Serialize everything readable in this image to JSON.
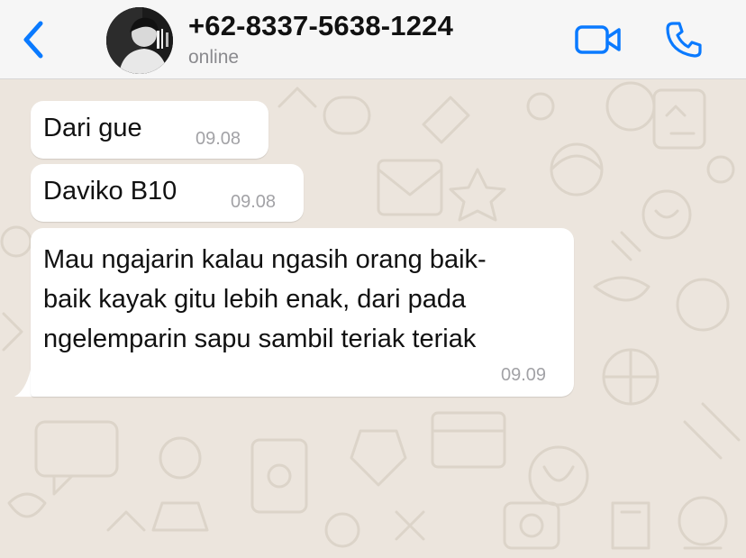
{
  "header": {
    "back_icon": "chevron-left-icon",
    "contact_name": "+62-8337-5638-1224",
    "status": "online",
    "video_icon": "video-camera-icon",
    "call_icon": "phone-icon",
    "accent_color": "#0a7aff"
  },
  "chat": {
    "wallpaper_color": "#ece5dd",
    "bubble_color": "#ffffff",
    "messages": [
      {
        "lines": [
          "Dari gue"
        ],
        "time": "09.08",
        "direction": "incoming"
      },
      {
        "lines": [
          "Daviko B10"
        ],
        "time": "09.08",
        "direction": "incoming"
      },
      {
        "lines": [
          "Mau ngajarin kalau ngasih orang baik-",
          "baik kayak gitu lebih enak, dari pada",
          "ngelemparin sapu sambil teriak teriak"
        ],
        "time": "09.09",
        "direction": "incoming"
      }
    ]
  }
}
